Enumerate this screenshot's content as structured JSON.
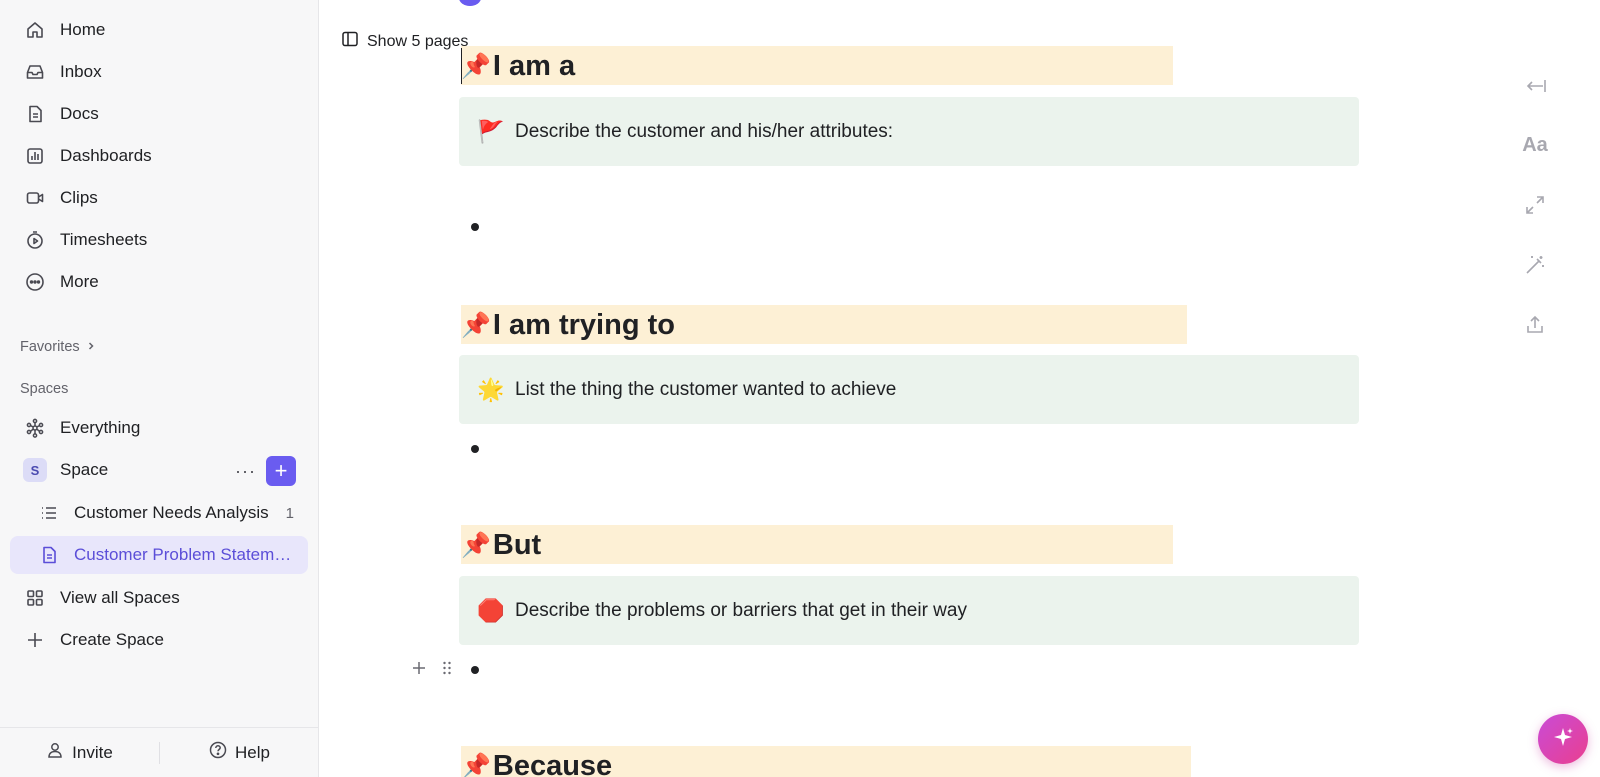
{
  "sidebar": {
    "nav": [
      {
        "label": "Home",
        "icon": "home-icon"
      },
      {
        "label": "Inbox",
        "icon": "inbox-icon"
      },
      {
        "label": "Docs",
        "icon": "doc-icon"
      },
      {
        "label": "Dashboards",
        "icon": "dashboard-icon"
      },
      {
        "label": "Clips",
        "icon": "video-icon"
      },
      {
        "label": "Timesheets",
        "icon": "timer-icon"
      },
      {
        "label": "More",
        "icon": "more-icon"
      }
    ],
    "favorites_label": "Favorites",
    "spaces_label": "Spaces",
    "everything_label": "Everything",
    "space": {
      "badge": "S",
      "label": "Space"
    },
    "space_items": [
      {
        "label": "Customer Needs Analysis",
        "count": "1",
        "icon": "list-icon"
      },
      {
        "label": "Customer Problem Statement",
        "icon": "doc-icon",
        "active": true
      }
    ],
    "view_all_label": "View all Spaces",
    "create_space_label": "Create Space",
    "footer": {
      "invite_label": "Invite",
      "help_label": "Help"
    }
  },
  "main": {
    "show_pages_label": "Show 5 pages",
    "sections": [
      {
        "heading": "I am a",
        "pin": "📌",
        "callout_emoji": "🚩",
        "callout_text": "Describe the customer and his/her attributes:"
      },
      {
        "heading": "I am trying to",
        "pin": "📌",
        "callout_emoji": "🌟",
        "callout_text": "List the thing the customer wanted to achieve"
      },
      {
        "heading": "But",
        "pin": "📌",
        "callout_emoji": "🛑",
        "callout_text": "Describe the problems or barriers that get in their way"
      },
      {
        "heading": "Because",
        "pin": "📌"
      }
    ]
  },
  "right_toolbar": {
    "font_label": "Aa",
    "tools": [
      "collapse-panel-icon",
      "font-style-icon",
      "expand-arrows-icon",
      "magic-wand-icon",
      "share-icon"
    ]
  },
  "colors": {
    "accent": "#6a5cf0",
    "heading_highlight": "#fdf0d5",
    "callout_bg": "#ebf3ed",
    "active_item_bg": "#e8e6fb"
  }
}
